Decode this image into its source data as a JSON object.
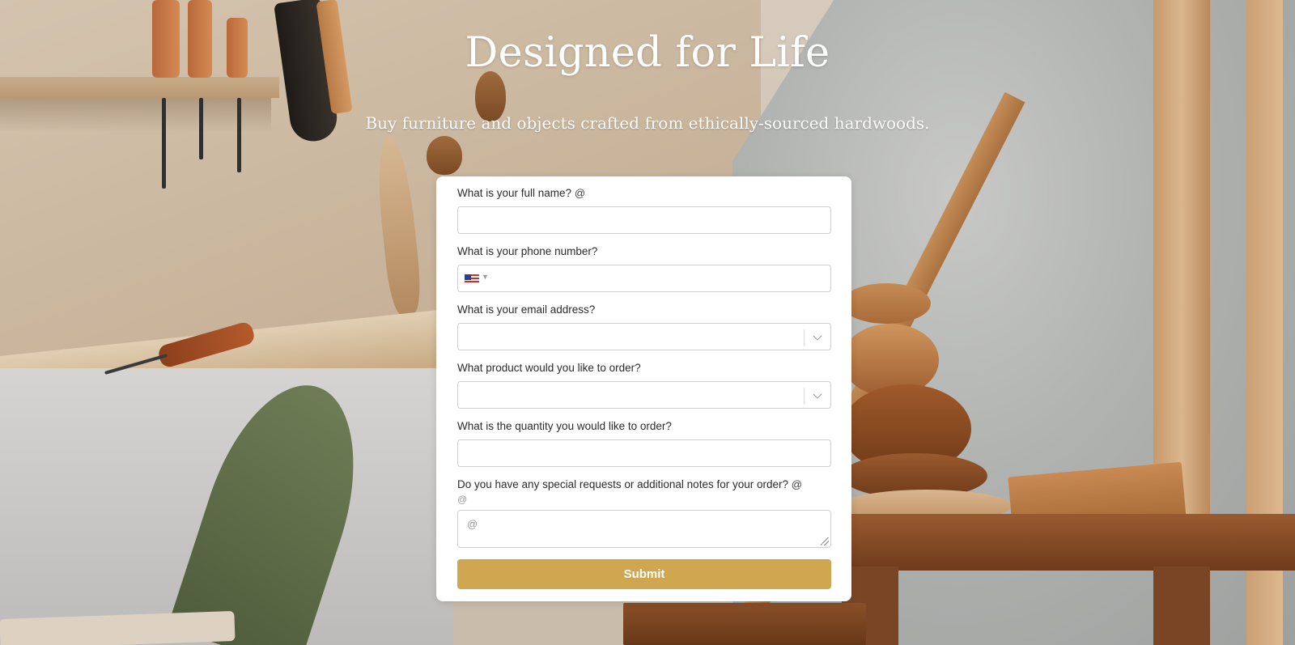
{
  "hero": {
    "title": "Designed for Life",
    "subtitle": "Buy furniture and objects crafted from ethically-sourced hardwoods."
  },
  "form": {
    "fields": [
      {
        "label": "What is your full name?",
        "mark": "@",
        "type": "text",
        "value": ""
      },
      {
        "label": "What is your phone number?",
        "type": "phone",
        "country_flag": "us-flag-icon",
        "value": ""
      },
      {
        "label": "What is your email address?",
        "type": "select",
        "value": ""
      },
      {
        "label": "What product would you like to order?",
        "type": "select",
        "value": ""
      },
      {
        "label": "What is the quantity you would like to order?",
        "type": "text",
        "value": ""
      },
      {
        "label": "Do you have any special requests or additional notes for your order?",
        "mark": "@",
        "hint": "@",
        "type": "textarea",
        "placeholder": "@",
        "value": ""
      }
    ],
    "submit_label": "Submit"
  },
  "colors": {
    "submit_button": "#cea750",
    "card_background": "#ffffff",
    "hero_text": "#ffffff"
  }
}
